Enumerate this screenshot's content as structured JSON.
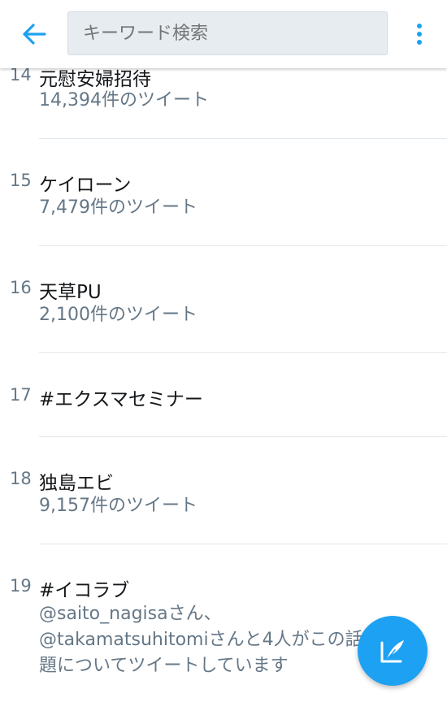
{
  "header": {
    "search_placeholder": "キーワード検索",
    "back_icon": "arrow-left-icon",
    "more_icon": "more-vertical-icon"
  },
  "accent_color": "#1da1f2",
  "trends": [
    {
      "rank": "14",
      "title": "元慰安婦招待",
      "subtitle": "14,394件のツイート"
    },
    {
      "rank": "15",
      "title": "ケイローン",
      "subtitle": "7,479件のツイート"
    },
    {
      "rank": "16",
      "title": "天草PU",
      "subtitle": "2,100件のツイート"
    },
    {
      "rank": "17",
      "title": "#エクスマセミナー"
    },
    {
      "rank": "18",
      "title": "独島エビ",
      "subtitle": "9,157件のツイート"
    },
    {
      "rank": "19",
      "title": "#イコラブ",
      "desc_lines": [
        "@saito_nagisaさん、",
        "@takamatsuhitomiさんと4人がこの話",
        "題についてツイートしています"
      ]
    }
  ],
  "fab": {
    "icon": "compose-tweet-icon"
  }
}
